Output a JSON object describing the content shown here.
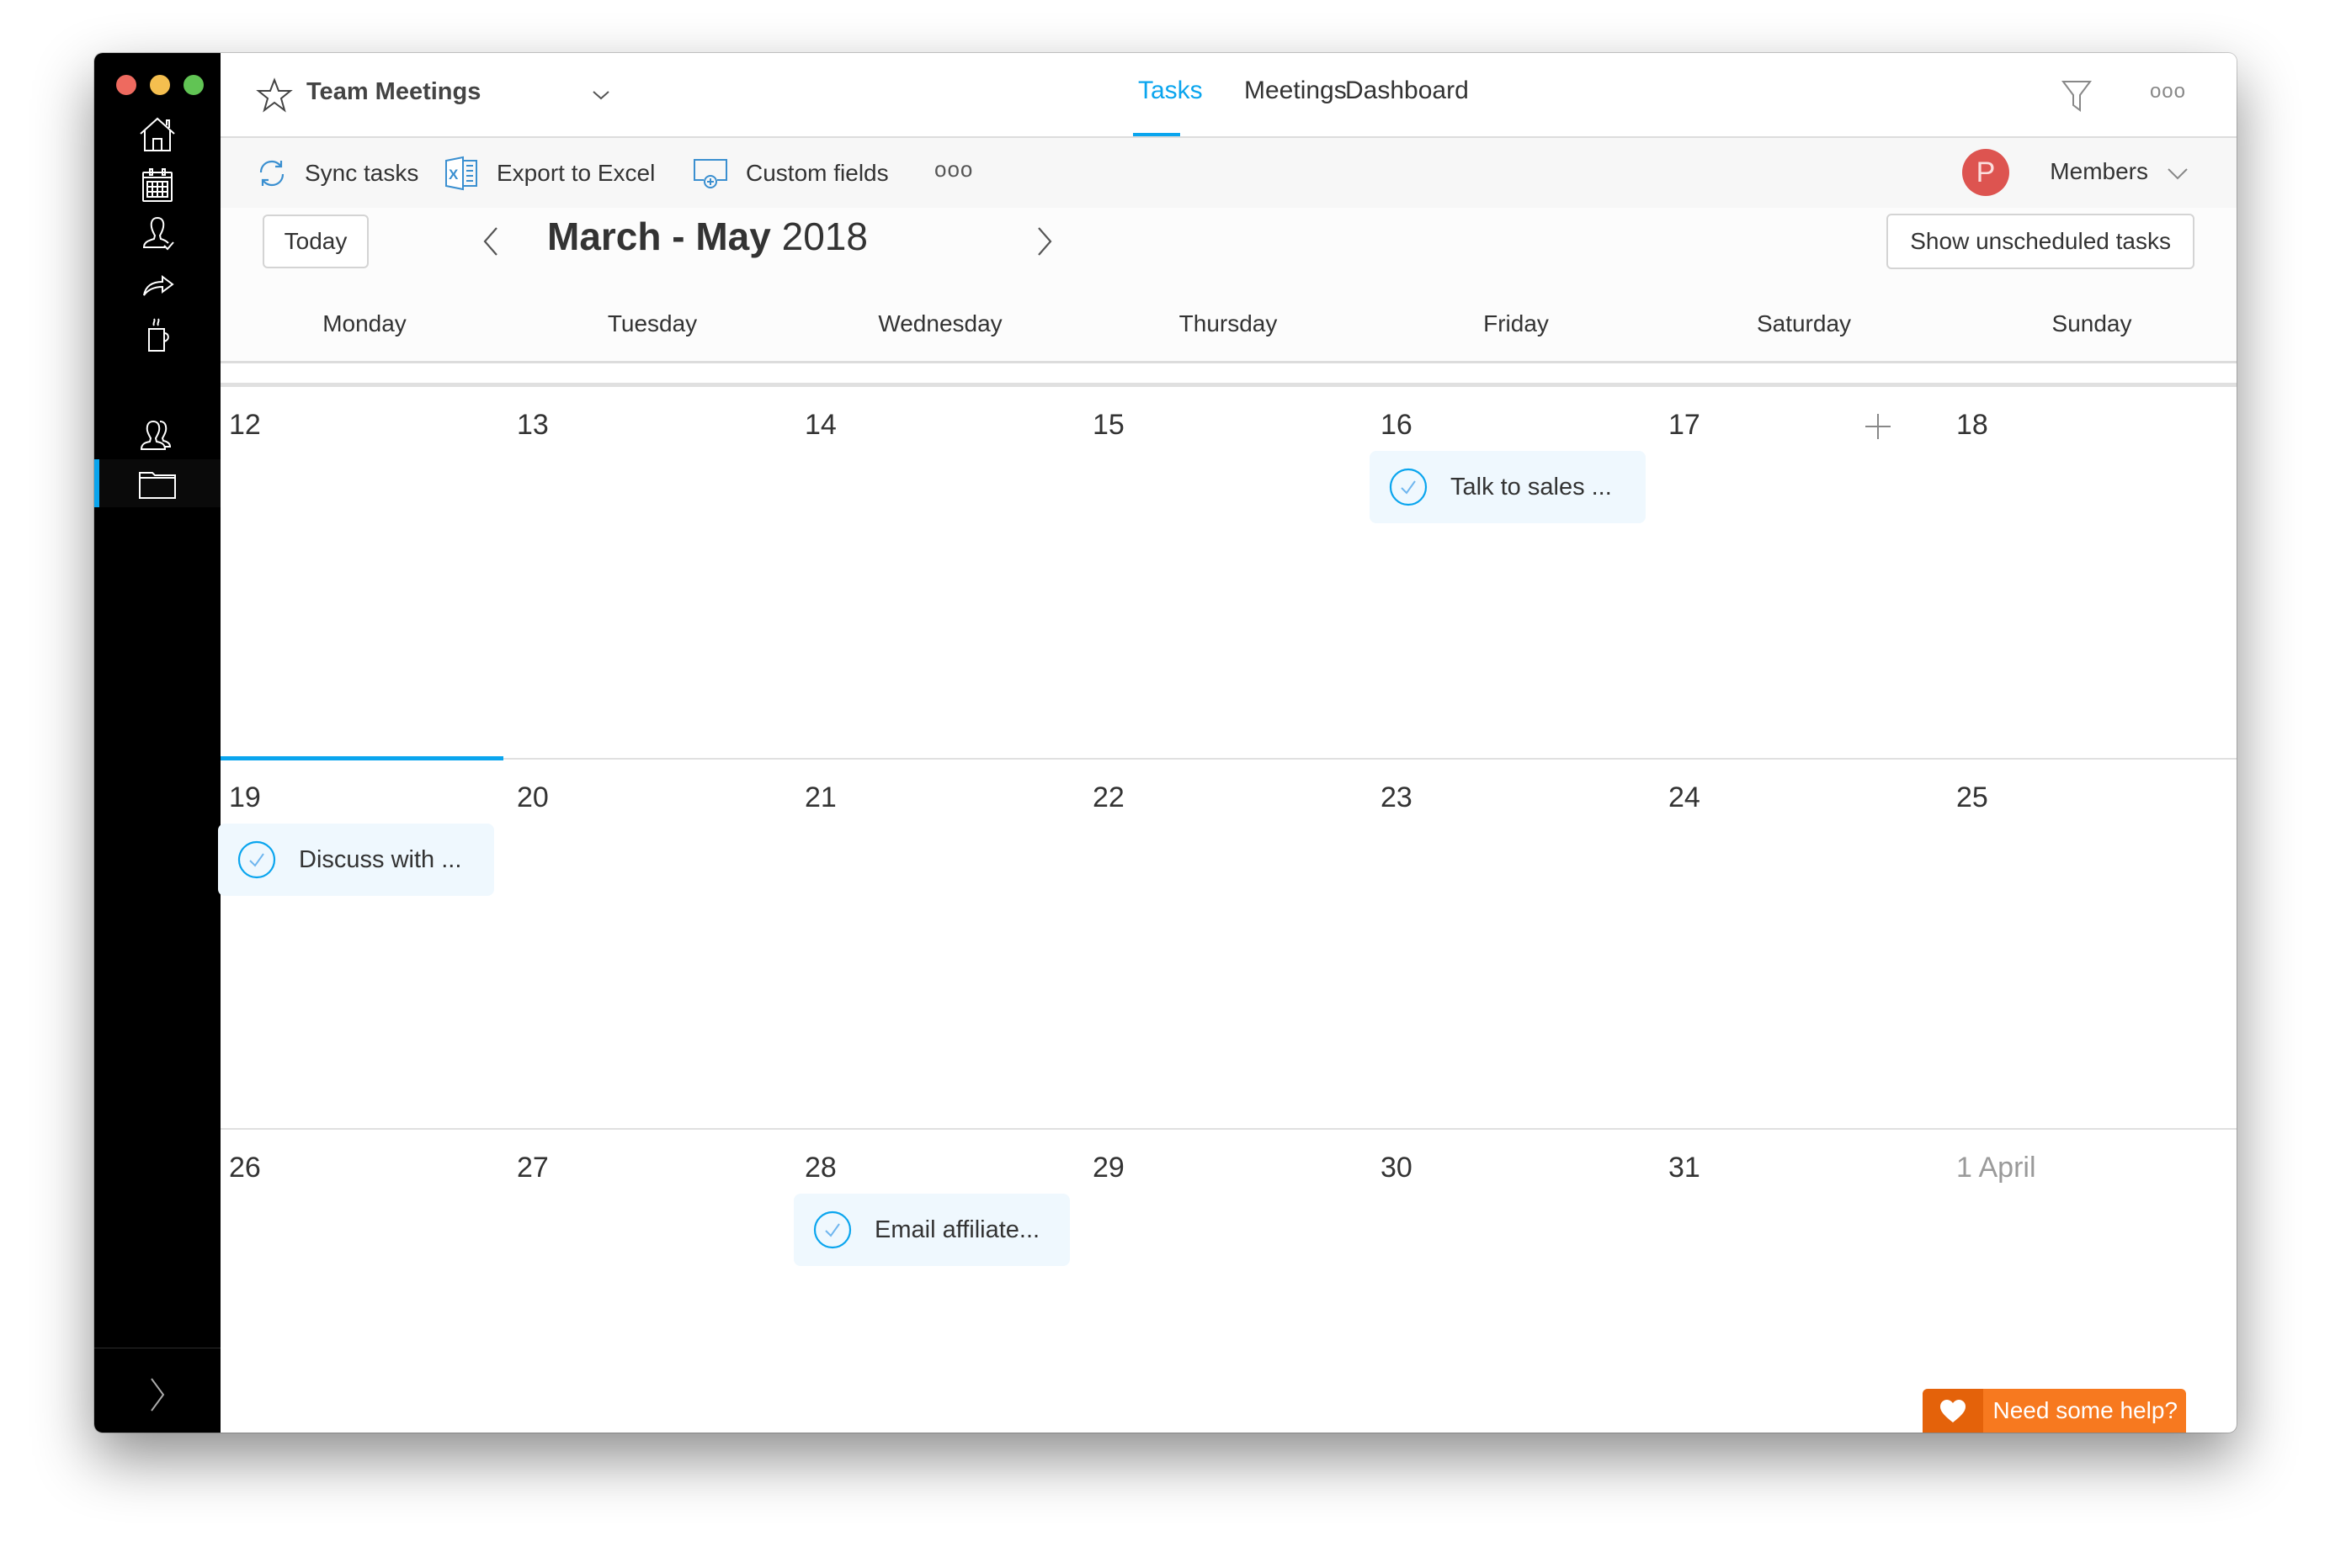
{
  "window": {
    "traffic_lights": [
      "close",
      "minimize",
      "maximize"
    ]
  },
  "sidebar": {
    "items": [
      {
        "icon": "home-icon",
        "label": "Home"
      },
      {
        "icon": "calendar-icon",
        "label": "Calendar"
      },
      {
        "icon": "user-check-icon",
        "label": "My work"
      },
      {
        "icon": "share-icon",
        "label": "Share"
      },
      {
        "icon": "coffee-icon",
        "label": "Break"
      },
      {
        "icon": "team-icon",
        "label": "Team"
      },
      {
        "icon": "folder-icon",
        "label": "Boards",
        "active": true
      }
    ],
    "expand_icon": "chevron-right-icon"
  },
  "header": {
    "board_title": "Team Meetings",
    "tabs": [
      {
        "label": "Tasks",
        "active": true
      },
      {
        "label": "Meetings",
        "active": false
      },
      {
        "label": "Dashboard",
        "active": false
      }
    ],
    "more": "ooo"
  },
  "toolbar": {
    "sync": "Sync tasks",
    "export": "Export to Excel",
    "custom_fields": "Custom fields",
    "more": "ooo",
    "avatar_initial": "P",
    "members": "Members"
  },
  "calendar": {
    "today_button": "Today",
    "range_bold": "March - May",
    "range_year": "2018",
    "show_unscheduled": "Show unscheduled tasks",
    "day_names": [
      "Monday",
      "Tuesday",
      "Wednesday",
      "Thursday",
      "Friday",
      "Saturday",
      "Sunday"
    ],
    "weeks": [
      {
        "days": [
          "12",
          "13",
          "14",
          "15",
          "16",
          "17",
          "18"
        ]
      },
      {
        "days": [
          "19",
          "20",
          "21",
          "22",
          "23",
          "24",
          "25"
        ]
      },
      {
        "days": [
          "26",
          "27",
          "28",
          "29",
          "30",
          "31",
          "1 April"
        ]
      }
    ],
    "events": [
      {
        "week": 0,
        "day": 4,
        "title": "Talk to sales ..."
      },
      {
        "week": 1,
        "day": 0,
        "title": "Discuss with ..."
      },
      {
        "week": 2,
        "day": 2,
        "title": "Email affiliate..."
      }
    ],
    "today": {
      "week": 1,
      "day": 0
    }
  },
  "help": {
    "label": "Need some help?"
  },
  "colors": {
    "accent": "#0aa5ee",
    "avatar": "#dd5450",
    "help_orange": "#f7791f",
    "chip_bg": "#eff8fe"
  }
}
